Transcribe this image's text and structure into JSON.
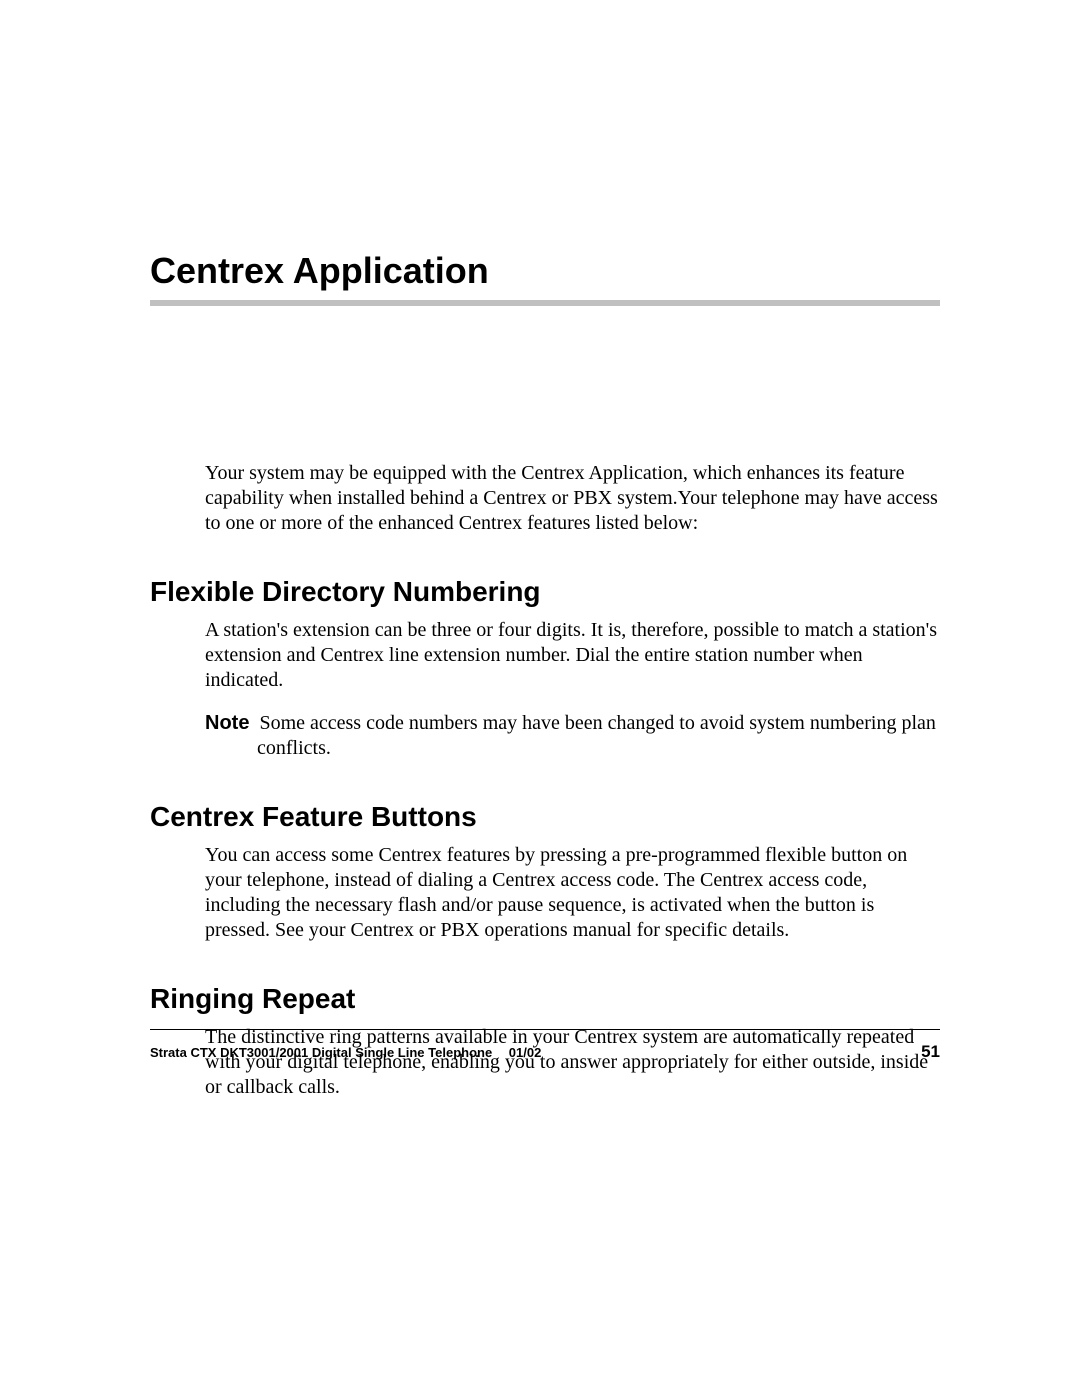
{
  "chapter": {
    "title": "Centrex Application"
  },
  "intro": "Your system may be equipped with the Centrex Application, which enhances its feature capability when installed behind a Centrex or PBX system.Your telephone may have access to one or more of the enhanced Centrex features listed below:",
  "sections": [
    {
      "heading": "Flexible Directory Numbering",
      "body": "A station's extension can be three or four digits. It is, therefore, possible to match a station's extension and Centrex line extension number. Dial the entire station number when indicated.",
      "note_label": "Note",
      "note_text": "Some access code numbers may have been changed to avoid system numbering plan conflicts."
    },
    {
      "heading": "Centrex Feature Buttons",
      "body": "You can access some Centrex features by pressing a pre-programmed flexible button on your telephone, instead of dialing a Centrex access code. The Centrex access code, including the necessary flash and/or pause sequence, is activated when the button is pressed. See your Centrex or PBX operations manual for specific details."
    },
    {
      "heading": "Ringing Repeat",
      "body": "The distinctive ring patterns available in your Centrex system are automatically repeated with your digital telephone, enabling you to answer appropriately for either outside, inside or callback calls."
    }
  ],
  "footer": {
    "doc_title": "Strata CTX DKT3001/2001 Digital Single Line Telephone  01/02",
    "page_number": "51"
  }
}
